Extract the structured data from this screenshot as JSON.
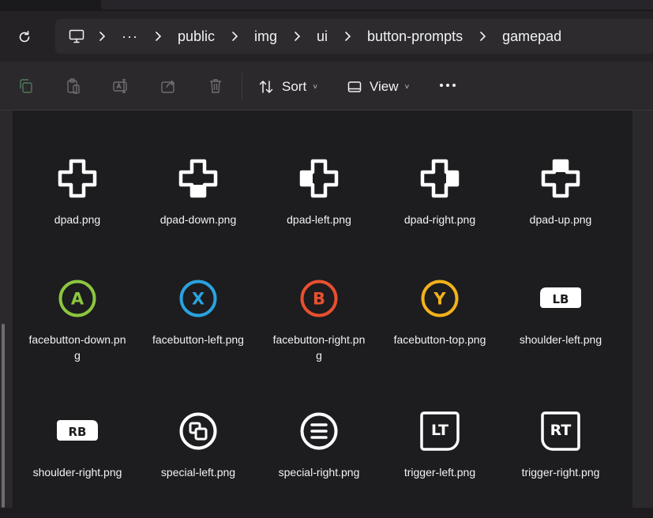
{
  "breadcrumb": {
    "items": [
      "public",
      "img",
      "ui",
      "button-prompts",
      "gamepad"
    ],
    "overflow": "···"
  },
  "toolbar": {
    "sort_label": "Sort",
    "view_label": "View"
  },
  "files": [
    {
      "name": "dpad.png",
      "icon": "dpad-icon"
    },
    {
      "name": "dpad-down.png",
      "icon": "dpad-down-icon"
    },
    {
      "name": "dpad-left.png",
      "icon": "dpad-left-icon"
    },
    {
      "name": "dpad-right.png",
      "icon": "dpad-right-icon"
    },
    {
      "name": "dpad-up.png",
      "icon": "dpad-up-icon"
    },
    {
      "name": "facebutton-down.png",
      "icon": "facebutton-a-icon",
      "glyph": "A",
      "color": "#8cc63f"
    },
    {
      "name": "facebutton-left.png",
      "icon": "facebutton-x-icon",
      "glyph": "X",
      "color": "#29a3e0"
    },
    {
      "name": "facebutton-right.png",
      "icon": "facebutton-b-icon",
      "glyph": "B",
      "color": "#e8502f"
    },
    {
      "name": "facebutton-top.png",
      "icon": "facebutton-y-icon",
      "glyph": "Y",
      "color": "#f2b21b"
    },
    {
      "name": "shoulder-left.png",
      "icon": "shoulder-lb-icon",
      "glyph": "LB"
    },
    {
      "name": "shoulder-right.png",
      "icon": "shoulder-rb-icon",
      "glyph": "RB"
    },
    {
      "name": "special-left.png",
      "icon": "special-left-icon"
    },
    {
      "name": "special-right.png",
      "icon": "special-right-icon"
    },
    {
      "name": "trigger-left.png",
      "icon": "trigger-lt-icon",
      "glyph": "LT"
    },
    {
      "name": "trigger-right.png",
      "icon": "trigger-rt-icon",
      "glyph": "RT"
    }
  ],
  "colors": {
    "background": "#1d1c1f",
    "toolbar": "#2b292c",
    "text": "#f2f2f2"
  }
}
